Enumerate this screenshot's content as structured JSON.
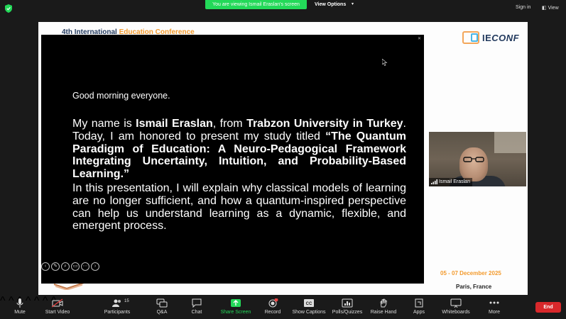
{
  "topbar": {
    "viewing_banner": "You are viewing Ismail Eraslan's screen",
    "view_options": "View Options",
    "sign_in": "Sign in",
    "view": "View"
  },
  "slide": {
    "conf_title_part1": "4th International ",
    "conf_title_part2": "Education Conference",
    "logo_text": "IE",
    "logo_text_italic": "CONF",
    "dates": "05 - 07 December 2025",
    "place": "Paris, France"
  },
  "shared_screen": {
    "greeting": "Good morning everyone.",
    "p1_a": "My name is ",
    "p1_b": "Ismail Eraslan",
    "p1_c": ", from ",
    "p1_d": "Trabzon University in Turkey",
    "p1_e": ". Today, I am honored to present my study titled ",
    "p1_f": "“The Quantum Paradigm of Education: A Neuro-Pedagogical Framework Integrating Uncertainty, Intuition, and Probability-Based Learning.”",
    "p2": "In this presentation, I will explain why classical models of learning are no longer sufficient, and how a quantum-inspired perspective can help us understand learning as a dynamic, flexible, and emergent process."
  },
  "video": {
    "participant_name": "Ismail Eraslan"
  },
  "toolbar": {
    "mute": "Mute",
    "start_video": "Start Video",
    "participants": "Participants",
    "participants_count": "15",
    "qa": "Q&A",
    "chat": "Chat",
    "share_screen": "Share Screen",
    "record": "Record",
    "show_captions": "Show Captions",
    "polls": "Polls/Quizzes",
    "raise_hand": "Raise Hand",
    "apps": "Apps",
    "whiteboards": "Whiteboards",
    "more": "More",
    "end": "End"
  },
  "colors": {
    "banner_green": "#23d959",
    "end_red": "#d8282b",
    "accent_orange": "#f39a2c",
    "navy": "#233a5e"
  }
}
